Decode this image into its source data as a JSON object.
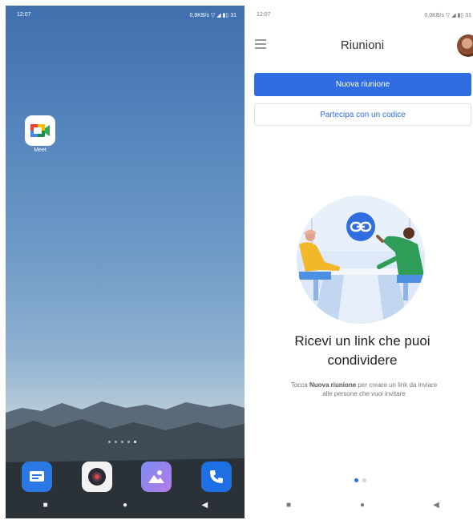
{
  "left_phone": {
    "status": {
      "time": "12:07",
      "right": "0,9KB/s ▽ ◢ ▮▯ 31"
    },
    "apps": [
      {
        "label": "Meet",
        "icon": "meet-icon"
      }
    ],
    "page_dots": {
      "count": 5,
      "active": 4
    },
    "dock": [
      {
        "icon": "messages-icon",
        "color": "#2a78e4"
      },
      {
        "icon": "camera-icon",
        "color": "#f2f2f2"
      },
      {
        "icon": "gallery-icon",
        "color": "#8f7df0"
      },
      {
        "icon": "phone-icon",
        "color": "#1e6fe3"
      }
    ],
    "nav": {
      "recents": "■",
      "home": "●",
      "back": "◀"
    }
  },
  "right_phone": {
    "status": {
      "time": "12:07",
      "right": "0,0KB/s ▽ ◢ ▮▯ 31"
    },
    "header": {
      "title": "Riunioni",
      "menu_icon": "menu-icon",
      "avatar_icon": "avatar-icon"
    },
    "new_meeting_label": "Nuova riunione",
    "join_code_label": "Partecipa con un codice",
    "illustration_icon": "link-icon",
    "heading_line1": "Ricevi un link che puoi",
    "heading_line2": "condividere",
    "body_pre": "Tocca ",
    "body_bold": "Nuova riunione",
    "body_post": " per creare un link da inviare alle persone che vuoi invitare",
    "pager": {
      "count": 2,
      "active": 0
    },
    "nav": {
      "recents": "■",
      "home": "●",
      "back": "◀"
    },
    "colors": {
      "accent": "#2f6de1"
    }
  }
}
